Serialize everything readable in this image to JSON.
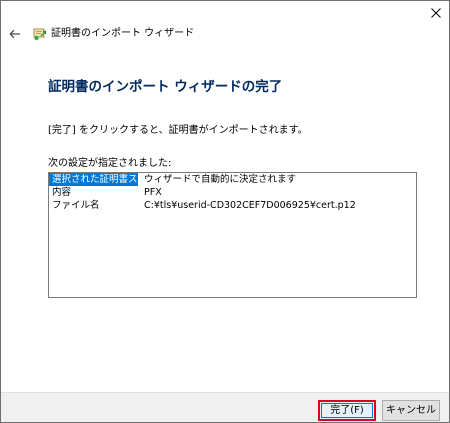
{
  "wizard": {
    "title": "証明書のインポート ウィザード",
    "heading": "証明書のインポート ウィザードの完了",
    "message": "[完了] をクリックすると、証明書がインポートされます。",
    "settings_label": "次の設定が指定されました:",
    "settings": [
      {
        "key": "選択された証明書ストア",
        "value": "ウィザードで自動的に決定されます",
        "selected": true
      },
      {
        "key": "内容",
        "value": "PFX",
        "selected": false
      },
      {
        "key": "ファイル名",
        "value": "C:¥tls¥userid-CD302CEF7D006925¥cert.p12",
        "selected": false
      }
    ]
  },
  "buttons": {
    "finish_label": "完了(F)",
    "cancel_label": "キャンセル"
  },
  "icons": {
    "close": "close-icon",
    "back": "back-arrow-icon",
    "wizard": "certificate-icon"
  },
  "colors": {
    "accent": "#0078d7",
    "heading": "#002a60",
    "highlight_border": "#e0001b"
  }
}
